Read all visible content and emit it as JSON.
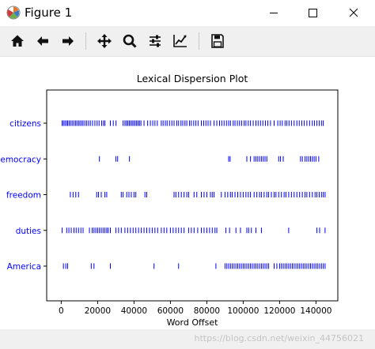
{
  "window": {
    "title": "Figure 1",
    "minimize_icon": "minimize-icon",
    "maximize_icon": "maximize-icon",
    "close_icon": "close-icon"
  },
  "toolbar": {
    "buttons": [
      {
        "name": "home-button",
        "icon": "home-icon"
      },
      {
        "name": "back-button",
        "icon": "arrow-left-icon"
      },
      {
        "name": "forward-button",
        "icon": "arrow-right-icon"
      },
      {
        "name": "pan-button",
        "icon": "move-icon"
      },
      {
        "name": "zoom-button",
        "icon": "magnifier-icon"
      },
      {
        "name": "configure-subplots-button",
        "icon": "sliders-icon"
      },
      {
        "name": "edit-axis-button",
        "icon": "line-chart-icon"
      },
      {
        "name": "save-button",
        "icon": "floppy-disk-icon"
      }
    ]
  },
  "chart_data": {
    "type": "scatter",
    "title": "Lexical Dispersion Plot",
    "xlabel": "Word Offset",
    "ylabel": "",
    "xlim": [
      -8000,
      152000
    ],
    "xticks": [
      0,
      20000,
      40000,
      60000,
      80000,
      100000,
      120000,
      140000
    ],
    "xtick_labels": [
      "0",
      "20000",
      "40000",
      "60000",
      "80000",
      "100000",
      "120000",
      "140000"
    ],
    "categories": [
      "citizens",
      "democracy",
      "freedom",
      "duties",
      "America"
    ],
    "marker": "|",
    "marker_color": "#0000ff",
    "tick_label_color": "#0000ff",
    "grid": false,
    "series": [
      {
        "name": "citizens",
        "x": [
          500,
          1200,
          2000,
          2800,
          3500,
          4300,
          5100,
          6000,
          6900,
          7800,
          8600,
          9500,
          10300,
          11200,
          12000,
          13000,
          14000,
          15000,
          16000,
          17200,
          18500,
          19700,
          20800,
          22200,
          23200,
          24000,
          27000,
          28600,
          30100,
          34000,
          35000,
          35800,
          36600,
          37400,
          38200,
          39000,
          39800,
          40600,
          41400,
          42200,
          43000,
          43800,
          45500,
          47500,
          49000,
          50300,
          51500,
          52800,
          55000,
          56000,
          57200,
          58200,
          59500,
          60800,
          62000,
          63500,
          64500,
          65800,
          66800,
          68000,
          69000,
          70500,
          71500,
          72800,
          74000,
          75200,
          77000,
          78300,
          79500,
          80700,
          82000,
          84000,
          85500,
          87000,
          88200,
          89500,
          90800,
          92000,
          93000,
          94500,
          95500,
          96800,
          98000,
          99200,
          100500,
          101500,
          102800,
          104000,
          105500,
          107000,
          108200,
          109500,
          110800,
          112200,
          113500,
          115000,
          117000,
          119000,
          120300,
          121500,
          123000,
          124000,
          125200,
          126500,
          128000,
          129500,
          130800,
          132200,
          133500,
          135000,
          136500,
          138000,
          139200,
          140500,
          141800,
          143000,
          144000
        ]
      },
      {
        "name": "democracy",
        "x": [
          21000,
          30000,
          31000,
          37500,
          92000,
          92800,
          102000,
          104000,
          106000,
          107000,
          108000,
          109000,
          110000,
          111000,
          112000,
          113000,
          119500,
          120500,
          122000,
          131500,
          132500,
          134000,
          135000,
          136000,
          137000,
          138000,
          139000,
          140000,
          141500
        ]
      },
      {
        "name": "freedom",
        "x": [
          5000,
          6500,
          8000,
          9500,
          19500,
          20500,
          22000,
          24000,
          25000,
          33000,
          34000,
          36000,
          37200,
          38500,
          40000,
          41000,
          46000,
          47000,
          62000,
          63000,
          64500,
          66000,
          67500,
          69000,
          70000,
          73000,
          74500,
          77000,
          78500,
          80000,
          82000,
          83000,
          84000,
          88000,
          90000,
          91500,
          93000,
          94000,
          95500,
          97000,
          98500,
          100000,
          101500,
          102800,
          104000,
          106000,
          107500,
          109000,
          110000,
          111500,
          113000,
          114000,
          115500,
          117000,
          118000,
          119500,
          121000,
          122500,
          123500,
          125000,
          126500,
          128000,
          129500,
          131000,
          132500,
          134000,
          135000,
          136500,
          138000,
          139500,
          140500,
          141800,
          143000,
          144000,
          145000
        ]
      },
      {
        "name": "duties",
        "x": [
          500,
          3000,
          4200,
          5500,
          7000,
          8200,
          9500,
          10800,
          12000,
          15500,
          17000,
          18000,
          19000,
          20000,
          21000,
          22000,
          23000,
          24000,
          25000,
          25800,
          27000,
          30000,
          31500,
          33000,
          35000,
          36500,
          38000,
          39500,
          41000,
          42500,
          44000,
          45500,
          47000,
          48500,
          50000,
          51500,
          53000,
          55000,
          56500,
          58000,
          60000,
          61500,
          63000,
          64500,
          66000,
          67500,
          70000,
          71500,
          73000,
          75000,
          77000,
          78500,
          80000,
          81500,
          83000,
          84500,
          85500,
          90500,
          92500,
          96000,
          98500,
          102000,
          103000,
          104500,
          107000,
          110000,
          125000,
          140500,
          142000,
          145000
        ]
      },
      {
        "name": "America",
        "x": [
          1200,
          2500,
          3500,
          16500,
          18000,
          27000,
          51000,
          64500,
          85000,
          90000,
          91000,
          92000,
          93000,
          94000,
          95000,
          96000,
          97000,
          98000,
          99000,
          100000,
          101000,
          102000,
          103000,
          104000,
          105000,
          106000,
          107000,
          108000,
          109000,
          110000,
          111000,
          112000,
          113000,
          114000,
          117000,
          118500,
          120000,
          121000,
          122000,
          123000,
          124000,
          125000,
          126000,
          127000,
          128000,
          129000,
          130000,
          131000,
          132000,
          133000,
          134000,
          135000,
          136000,
          137000,
          138000,
          139000,
          140000,
          141000,
          142000,
          143000,
          144000,
          145000
        ]
      }
    ]
  },
  "statusbar": {
    "watermark": "https://blog.csdn.net/weixin_44756021"
  }
}
